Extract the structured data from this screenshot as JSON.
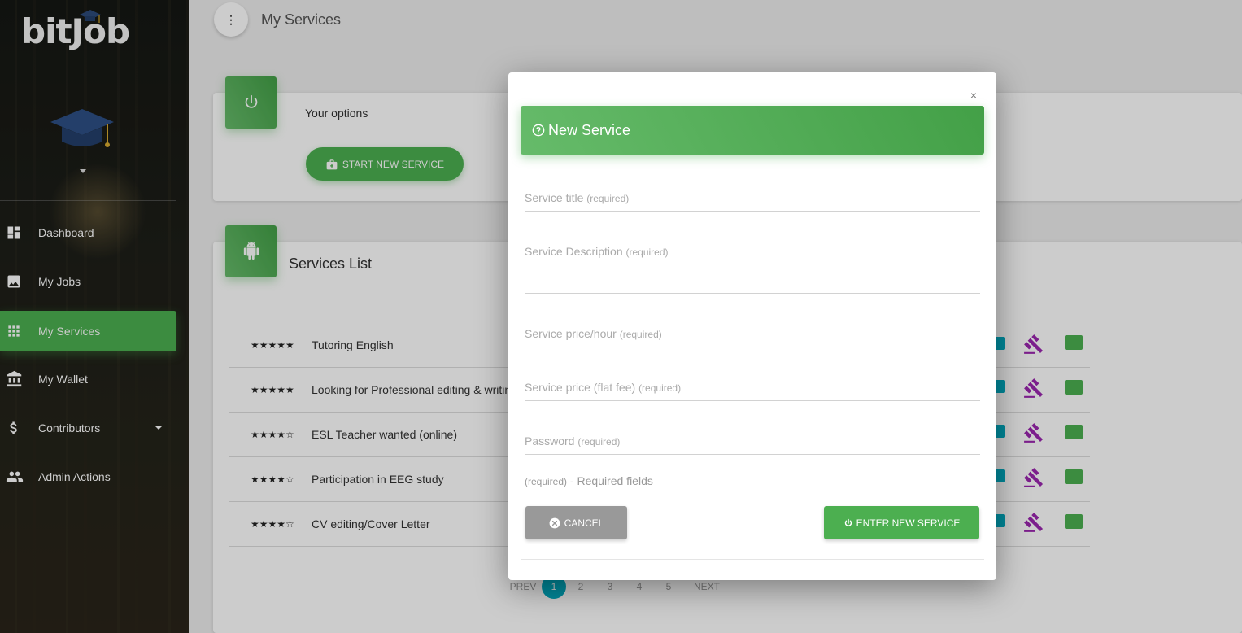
{
  "app": {
    "logo_text": "bitJob",
    "page_title": "My Services"
  },
  "sidebar": {
    "items": [
      {
        "label": "Dashboard",
        "icon": "dashboard-icon"
      },
      {
        "label": "My Jobs",
        "icon": "image-icon"
      },
      {
        "label": "My Services",
        "icon": "apps-grid-icon",
        "active": true
      },
      {
        "label": "My Wallet",
        "icon": "bank-icon"
      },
      {
        "label": "Contributors",
        "icon": "dollar-icon",
        "has_submenu": true
      },
      {
        "label": "Admin Actions",
        "icon": "people-icon"
      }
    ]
  },
  "options_card": {
    "label": "Your options",
    "start_button": "START NEW SERVICE"
  },
  "services_list": {
    "title": "Services List",
    "rows": [
      {
        "stars": "★★★★★",
        "title": "Tutoring English"
      },
      {
        "stars": "★★★★★",
        "title": "Looking for Professional editing & writin"
      },
      {
        "stars": "★★★★☆",
        "title": "ESL Teacher wanted (online)"
      },
      {
        "stars": "★★★★☆",
        "title": "Participation in EEG study"
      },
      {
        "stars": "★★★★☆",
        "title": "CV editing/Cover Letter"
      }
    ],
    "pagination": {
      "prev": "PREV",
      "pages": [
        "1",
        "2",
        "3",
        "4",
        "5"
      ],
      "current": "1",
      "next": "NEXT"
    }
  },
  "modal": {
    "close": "×",
    "title": "New Service",
    "fields": [
      {
        "label": "Service title",
        "req": "(required)"
      },
      {
        "label": "Service Description",
        "req": "(required)"
      },
      {
        "label": "Service price/hour",
        "req": "(required)"
      },
      {
        "label": "Service price (flat fee)",
        "req": "(required)"
      },
      {
        "label": "Password",
        "req": "(required)"
      }
    ],
    "required_note_req": "(required)",
    "required_note_text": " - Required fields",
    "cancel_label": "CANCEL",
    "enter_label": "ENTER NEW SERVICE"
  },
  "colors": {
    "accent": "#4caf50",
    "sidebar_bg": "#1d1e18",
    "purple_action": "#9c27b0",
    "cyan_action": "#00acc1"
  }
}
